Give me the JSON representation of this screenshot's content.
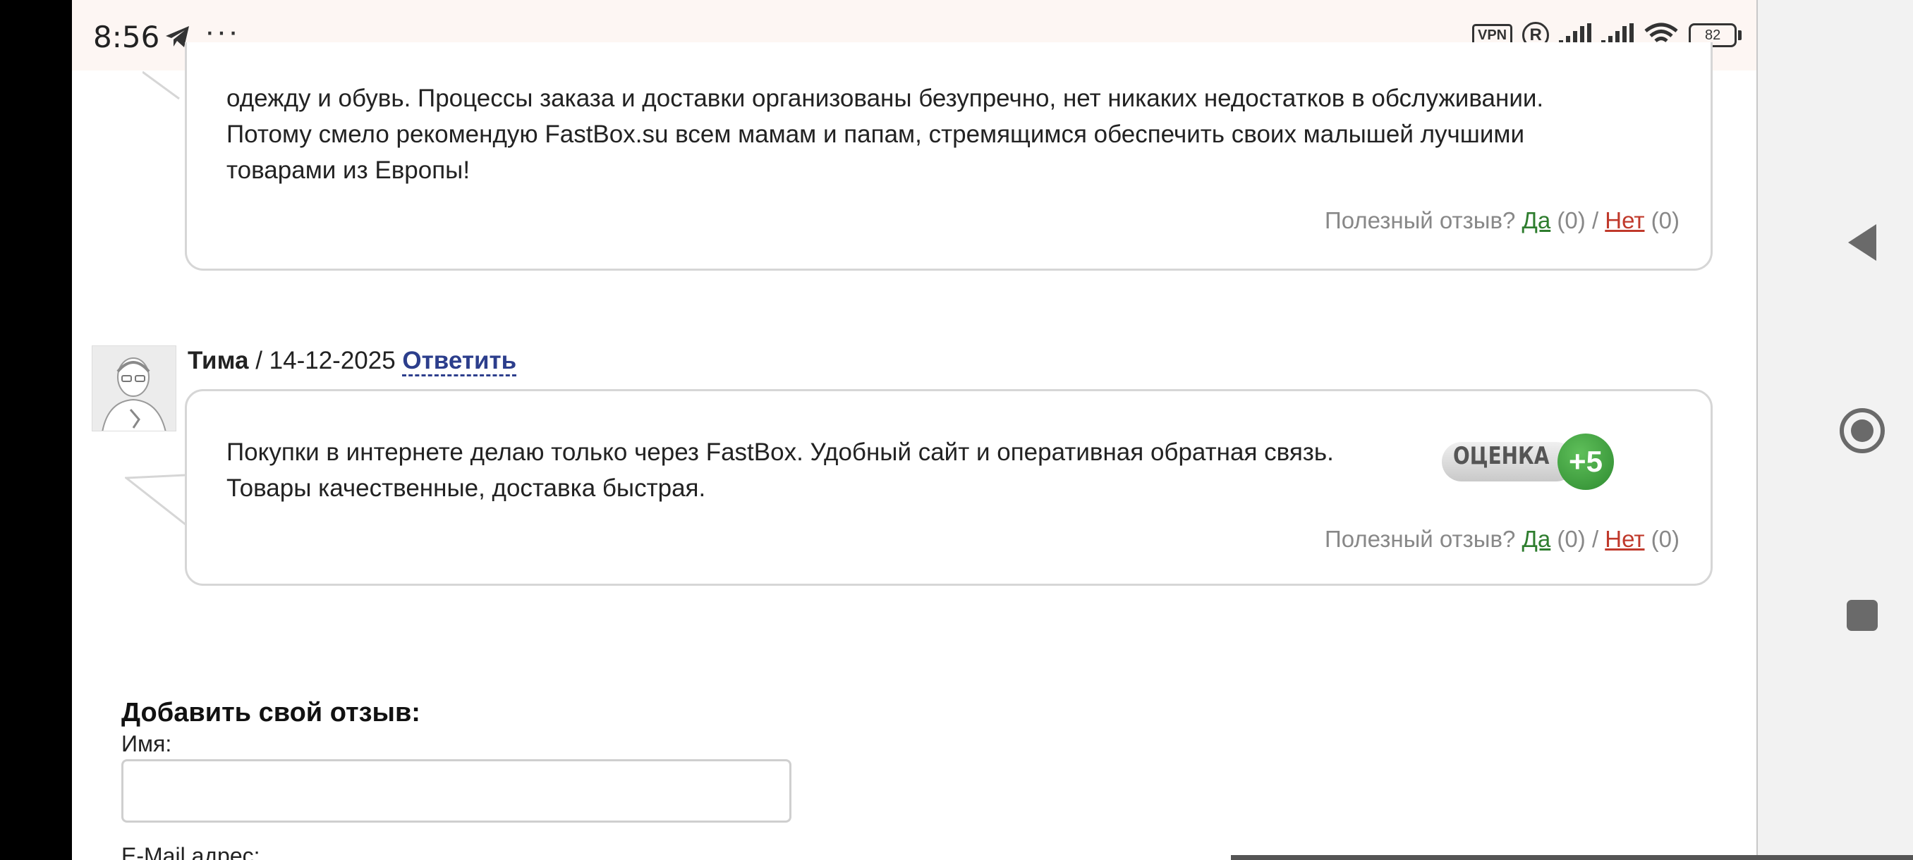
{
  "status_bar": {
    "time": "8:56",
    "more": "···",
    "vpn": "VPN",
    "registered": "R",
    "battery": "82"
  },
  "reviews": [
    {
      "text": "одежду и обувь. Процессы заказа и доставки организованы безупречно, нет никаких недостатков в обслуживании.\nПотому смело рекомендую FastBox.su всем мамам и папам, стремящимся обеспечить своих малышей лучшими\nтоварами из Европы!",
      "helpful": {
        "question": "Полезный отзыв?",
        "yes": "Да",
        "yes_count": "(0)",
        "sep": "/",
        "no": "Нет",
        "no_count": "(0)"
      }
    },
    {
      "author": "Тима",
      "date": "/ 14-12-2025",
      "reply": "Ответить",
      "text": "Покупки в интернете делаю только через FastBox. Удобный сайт и оперативная обратная связь.\nТовары качественные, доставка быстрая.",
      "rating_label": "ОЦЕНКА",
      "rating_value": "+5",
      "helpful": {
        "question": "Полезный отзыв?",
        "yes": "Да",
        "yes_count": "(0)",
        "sep": "/",
        "no": "Нет",
        "no_count": "(0)"
      }
    }
  ],
  "form": {
    "title": "Добавить свой отзыв:",
    "name_label": "Имя:",
    "email_label": "E-Mail адрес:",
    "name_value": ""
  },
  "icons": [
    "telegram-icon",
    "wifi-icon",
    "signal-icon",
    "battery-icon",
    "back-icon",
    "home-icon",
    "recents-icon"
  ]
}
